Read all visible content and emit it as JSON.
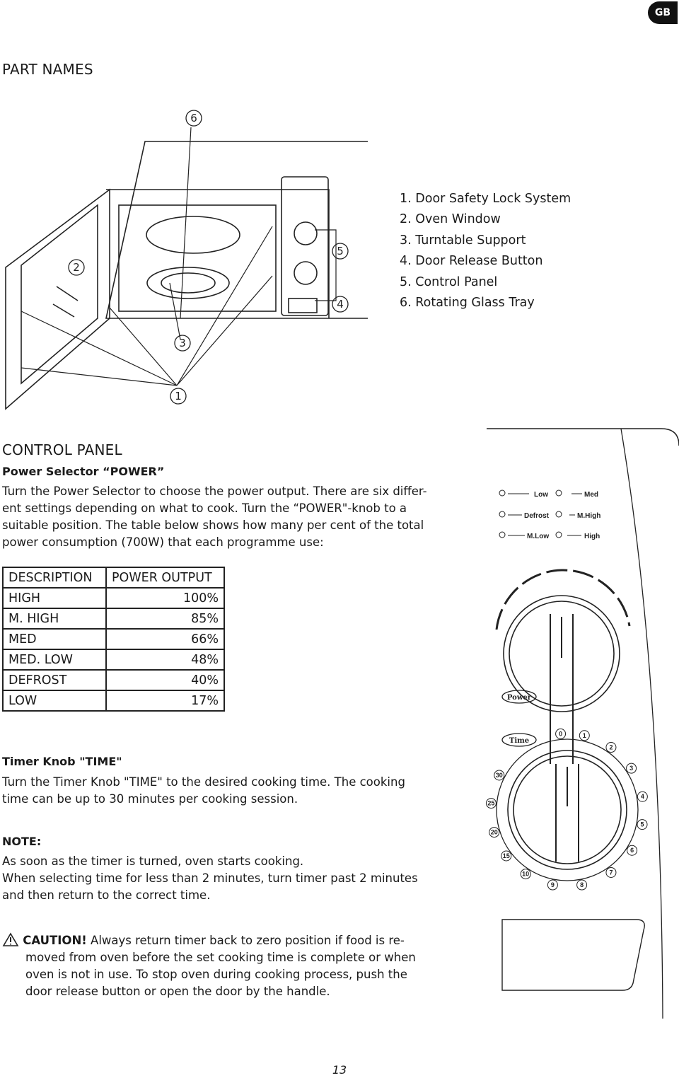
{
  "badge": "GB",
  "part_names": {
    "title": "PART NAMES",
    "callouts": [
      "1",
      "2",
      "3",
      "4",
      "5",
      "6"
    ],
    "items": [
      "1.  Door Safety Lock System",
      "2.  Oven Window",
      "3.  Turntable Support",
      "4.  Door Release Button",
      "5.  Control Panel",
      "6.  Rotating Glass Tray"
    ]
  },
  "control_panel": {
    "title": "CONTROL PANEL",
    "power_heading": "Power Selector “POWER”",
    "power_lines": [
      "Turn the Power Selector to choose the power output. There are six differ-",
      "ent settings depending on what to cook. Turn the “POWER\"-knob to a",
      "suitable position. The table below shows how many per cent of the total",
      "power consumption (700W) that each programme use:"
    ],
    "table": {
      "headers": [
        "DESCRIPTION",
        "POWER OUTPUT"
      ],
      "rows": [
        [
          "HIGH",
          "100%"
        ],
        [
          "M. HIGH",
          "85%"
        ],
        [
          "MED",
          "66%"
        ],
        [
          "MED. LOW",
          "48%"
        ],
        [
          "DEFROST",
          "40%"
        ],
        [
          "LOW",
          "17%"
        ]
      ]
    },
    "timer_heading": "Timer Knob \"TIME\"",
    "timer_lines": [
      "Turn the Timer Knob \"TIME\" to the desired cooking time. The cooking",
      "time can be up to 30 minutes per cooking session."
    ],
    "note_heading": "NOTE:",
    "note_lines": [
      "As soon as the timer is turned, oven starts cooking.",
      "When selecting time for less than 2 minutes, turn timer past 2 minutes",
      "and then return to the correct time."
    ],
    "caution_label": "CAUTION!",
    "caution_lines": [
      " Always return timer back to zero position if food is re-",
      "moved from oven before the set cooking time is complete or when",
      "oven is not in use. To stop oven during cooking process, push the",
      "door release button or open the door by the handle."
    ]
  },
  "panel_drawing": {
    "legend": [
      "Low",
      "Med",
      "Defrost",
      "M.High",
      "M.Low",
      "High"
    ],
    "power_label": "Power",
    "time_label": "Time",
    "time_marks": [
      "0",
      "1",
      "2",
      "3",
      "4",
      "5",
      "6",
      "7",
      "8",
      "9",
      "10",
      "15",
      "20",
      "25",
      "30"
    ]
  },
  "page_number": "13"
}
